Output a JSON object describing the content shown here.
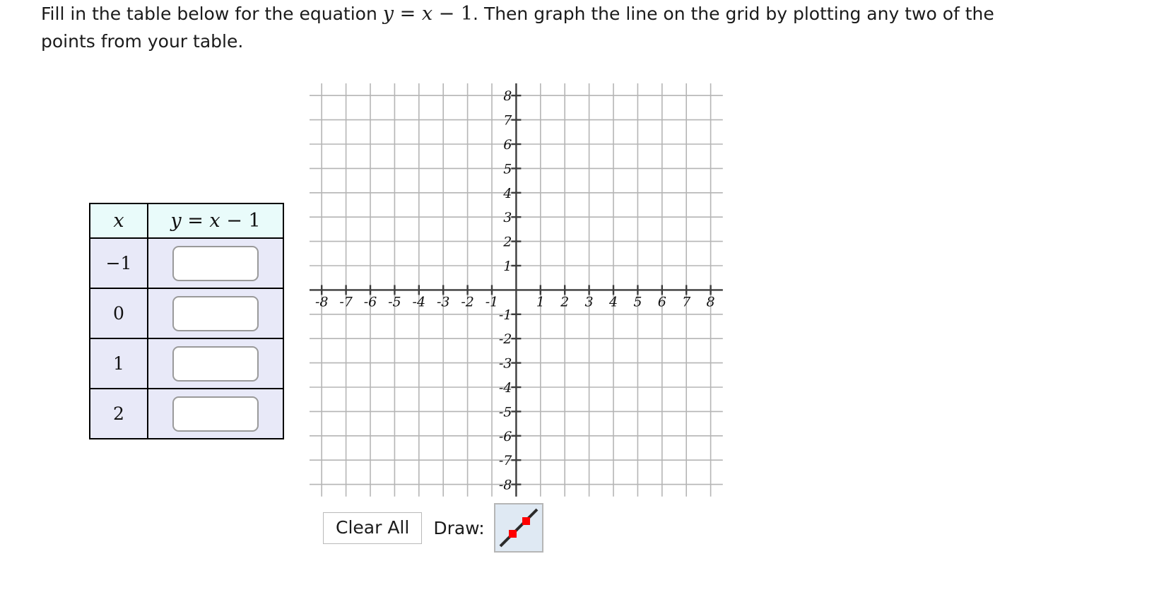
{
  "prompt": {
    "part1": "Fill in the table below for the equation ",
    "eq_y": "y",
    "eq_eq": " = ",
    "eq_x": "x",
    "eq_minus": " − ",
    "eq_one": "1",
    "part2": ". Then graph the line on the grid by plotting any two of the points from your table."
  },
  "table": {
    "headers": {
      "x": "x",
      "y_expr_y": "y",
      "y_expr_eq": " = ",
      "y_expr_x": "x",
      "y_expr_minus": " − ",
      "y_expr_one": "1"
    },
    "rows": [
      {
        "x": "−1",
        "y_value": ""
      },
      {
        "x": "0",
        "y_value": ""
      },
      {
        "x": "1",
        "y_value": ""
      },
      {
        "x": "2",
        "y_value": ""
      }
    ],
    "header_bg": "#e9fbfa",
    "row_bg": "#e8e9f8",
    "input_placeholder": ""
  },
  "controls": {
    "clear_all_label": "Clear All",
    "draw_label": "Draw:",
    "draw_tool_name": "line-segment-tool",
    "draw_tool_bg": "#dfe9f3",
    "draw_point_color": "#ff0000",
    "draw_line_color": "#2b2b2b"
  },
  "chart_data": {
    "type": "scatter",
    "title": "",
    "xlabel": "",
    "ylabel": "",
    "xlim": [
      -8.5,
      8.5
    ],
    "ylim": [
      -8.5,
      8.5
    ],
    "grid": true,
    "legend": null,
    "x_ticks": [
      -8,
      -7,
      -6,
      -5,
      -4,
      -3,
      -2,
      -1,
      1,
      2,
      3,
      4,
      5,
      6,
      7,
      8
    ],
    "y_ticks": [
      8,
      7,
      6,
      5,
      4,
      3,
      2,
      1,
      -1,
      -2,
      -3,
      -4,
      -5,
      -6,
      -7,
      -8
    ],
    "x_tick_labels": [
      "-8",
      "-7",
      "-6",
      "-5",
      "-4",
      "-3",
      "-2",
      "-1",
      "1",
      "2",
      "3",
      "4",
      "5",
      "6",
      "7",
      "8"
    ],
    "y_tick_labels": [
      "8",
      "7",
      "6",
      "5",
      "4",
      "3",
      "2",
      "1",
      "-1",
      "-2",
      "-3",
      "-4",
      "-5",
      "-6",
      "-7",
      "-8"
    ],
    "series": [],
    "values": [],
    "categories": [],
    "axis_color": "#3c3c3c",
    "grid_color": "#b5b5b5",
    "grid_spacing_units": 1
  }
}
